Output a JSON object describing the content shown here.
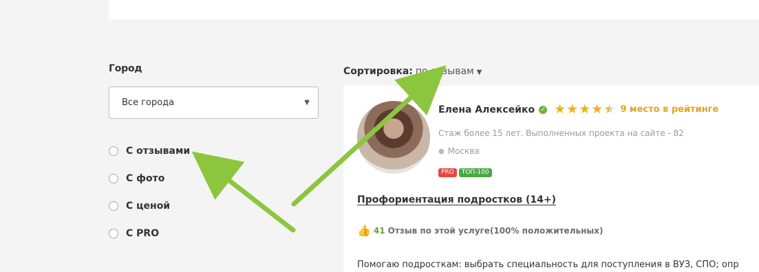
{
  "filters": {
    "city_label": "Город",
    "city_select_value": "Все города",
    "options": [
      "С отзывами",
      "С фото",
      "С ценой",
      "С PRO"
    ]
  },
  "sort": {
    "label": "Сортировка:",
    "value": "по отзывам"
  },
  "card": {
    "name": "Елена Алексейко",
    "rating_place": "9 место в рейтинге",
    "rating_stars": 4.5,
    "experience": "Стаж более 15 лет. Выполненных проекта на сайте - 82",
    "city": "Москва",
    "badges": [
      "PRO",
      "ТОП-100"
    ],
    "service_title": "Профориентация подростков (14+)",
    "reviews_count": "41",
    "reviews_text": "Отзыв по этой услуге(100% положительных)",
    "description": "Помогаю подросткам: выбрать специальность для поступления в ВУЗ, СПО; опр"
  },
  "icons": {
    "verified": "check-circle-icon",
    "star": "star-icon",
    "pin": "location-pin-icon",
    "thumb": "thumbs-up-icon",
    "arrow": "annotation-arrow"
  },
  "colors": {
    "accent_green": "#6db33f",
    "star_gold": "#f2b01e",
    "rating_orange": "#e8a21a",
    "badge_red": "#e5473e",
    "badge_green": "#4aa746",
    "arrow_green": "#8cc63f"
  }
}
